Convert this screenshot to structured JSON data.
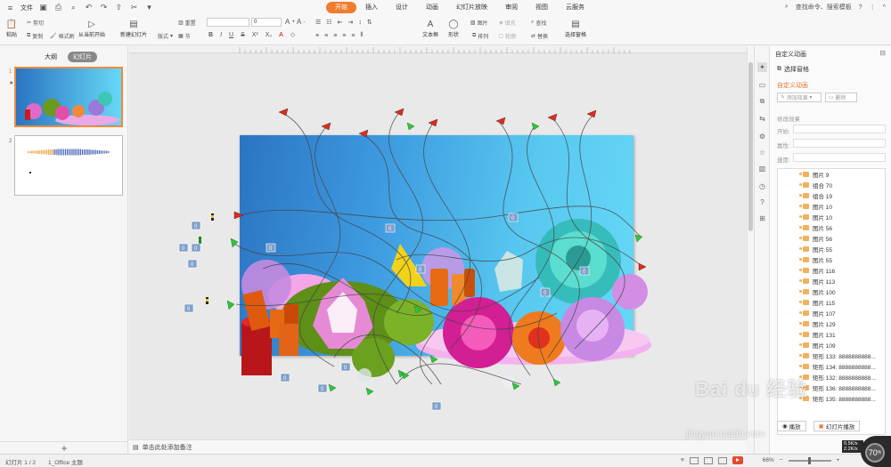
{
  "menubar": {
    "file": "文件",
    "tabs": [
      "开始",
      "插入",
      "设计",
      "动画",
      "幻灯片放映",
      "审阅",
      "视图",
      "云服务"
    ],
    "active_tab": "开始",
    "search": "查找命令、搜索模板"
  },
  "ribbon": {
    "paste": "粘贴",
    "cut": "剪切",
    "copy": "复制",
    "format_painter": "格式刷",
    "from_current": "从当前开始",
    "new_slide": "新建幻灯片",
    "layout": "版式",
    "section": "节",
    "reset": "重置",
    "font_size": "0",
    "textbox": "文本框",
    "shape": "形状",
    "arrange": "排列",
    "outline": "轮廓",
    "picture": "图片",
    "fill": "填充",
    "find": "查找",
    "replace": "替换",
    "select_pane": "选择窗格"
  },
  "leftpanel": {
    "tab_outline": "大纲",
    "tab_slides": "幻灯片",
    "slide_nums": [
      "1",
      "2"
    ]
  },
  "notes_placeholder": "单击此处添加备注",
  "rightpanel": {
    "title": "自定义动画",
    "select_pane": "选择窗格",
    "custom_anim": "自定义动画",
    "add_effect": "添加效果",
    "delete": "删除",
    "modify_effect": "修改效果",
    "start": "开始:",
    "property": "属性:",
    "speed": "速度:",
    "items": [
      "图片 9",
      "组合 70",
      "组合 19",
      "图片 10",
      "图片 10",
      "图片 56",
      "图片 56",
      "图片 55",
      "图片 55",
      "图片 116",
      "图片 113",
      "图片 100",
      "图片 115",
      "图片 107",
      "图片 129",
      "图片 131",
      "图片 109",
      "矩形 133: 8888888888...",
      "矩形 134: 8888888888...",
      "矩形 132: 8888888888...",
      "矩形 136: 8888888888...",
      "矩形 135: 8888888888..."
    ],
    "play": "播放",
    "slideshow": "幻灯片播放"
  },
  "statusbar": {
    "slide_pos": "幻灯片 1 / 2",
    "theme": "1_Office 主题",
    "zoom": "66%"
  },
  "speed": {
    "percent": "70",
    "unit": "%",
    "up": "0.5K/s",
    "down": "2.2K/s"
  },
  "watermark": {
    "main": "Bai du 经验",
    "sub": "jingyan.baidu.com"
  },
  "anim_label": "0",
  "colors": {
    "accent": "#f07c2c",
    "slide_from": "#2b74c2",
    "slide_to": "#66d8f6"
  }
}
